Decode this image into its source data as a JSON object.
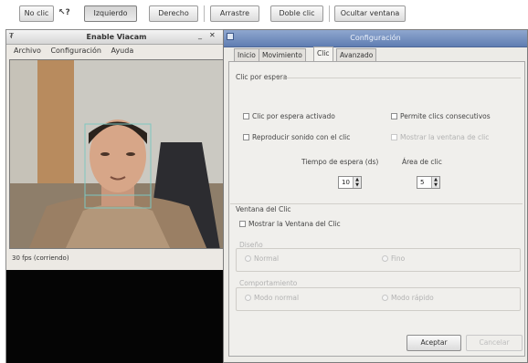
{
  "toolbar": {
    "items": [
      "No clic",
      "Izquierdo",
      "Derecho",
      "Arrastre",
      "Doble clic",
      "Ocultar ventana"
    ]
  },
  "viacam": {
    "title": "Enable Viacam",
    "menu": [
      "Archivo",
      "Configuración",
      "Ayuda"
    ],
    "status": "30 fps (corriendo)"
  },
  "config": {
    "title": "Configuración",
    "tabs": [
      "Inicio",
      "Movimiento",
      "Clic",
      "Avanzado"
    ],
    "active_tab": "Clic",
    "dwell_section": "Clic por espera",
    "dwell_enabled": "Clic por espera activado",
    "allow_consecutive": "Permite clics consecutivos",
    "play_sound": "Reproducir sonido con el clic",
    "disabled_option": "Mostrar la ventana de clic",
    "dwell_time_label": "Tiempo de espera (ds)",
    "dwell_time_value": "10",
    "click_area_label": "Área de clic",
    "click_area_value": "5",
    "click_window_section": "Ventana del Clic",
    "show_click_window": "Mostrar la Ventana del Clic",
    "design_label": "Diseño",
    "design_normal": "Normal",
    "design_thin": "Fino",
    "behavior_label": "Comportamiento",
    "behavior_normal": "Modo normal",
    "behavior_fast": "Modo rápido",
    "accept_button": "Aceptar",
    "cancel_button": "Cancelar"
  }
}
